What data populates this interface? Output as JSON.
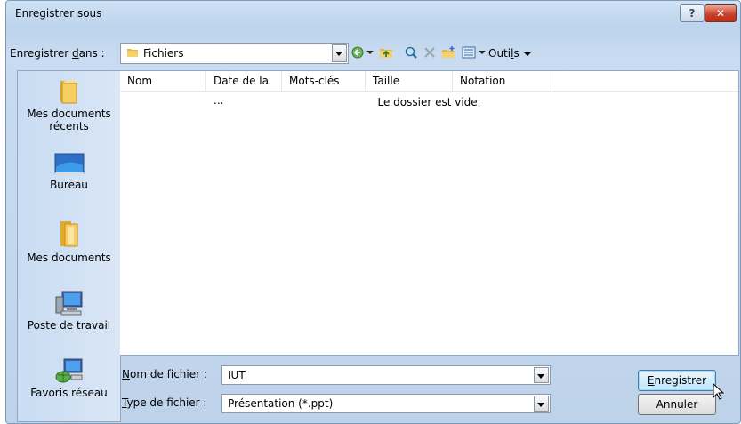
{
  "window": {
    "title": "Enregistrer sous"
  },
  "titlebar": {
    "help_label": "?",
    "close_label": "✕"
  },
  "location": {
    "label_pre": "Enregistrer ",
    "label_accel": "d",
    "label_post": "ans :",
    "value": "Fichiers"
  },
  "toolbar": {
    "tools_pre": "Outi",
    "tools_accel": "l",
    "tools_post": "s"
  },
  "places": [
    {
      "id": "recent",
      "label": "Mes documents récents",
      "icon": "recent-folder-icon"
    },
    {
      "id": "desktop",
      "label": "Bureau",
      "icon": "desktop-icon"
    },
    {
      "id": "documents",
      "label": "Mes documents",
      "icon": "documents-folder-icon"
    },
    {
      "id": "computer",
      "label": "Poste de travail",
      "icon": "computer-icon"
    },
    {
      "id": "network",
      "label": "Favoris réseau",
      "icon": "network-icon"
    }
  ],
  "columns": [
    "Nom",
    "Date de la ...",
    "Mots-clés",
    "Taille",
    "Notation"
  ],
  "empty_message": "Le dossier est vide.",
  "filename": {
    "label_accel": "N",
    "label_rest": "om de fichier :",
    "value": "IUT"
  },
  "filetype": {
    "label_accel": "T",
    "label_rest": "ype de fichier :",
    "value": "Présentation (*.ppt)"
  },
  "buttons": {
    "save_accel": "E",
    "save_rest": "nregistrer",
    "cancel": "Annuler"
  }
}
